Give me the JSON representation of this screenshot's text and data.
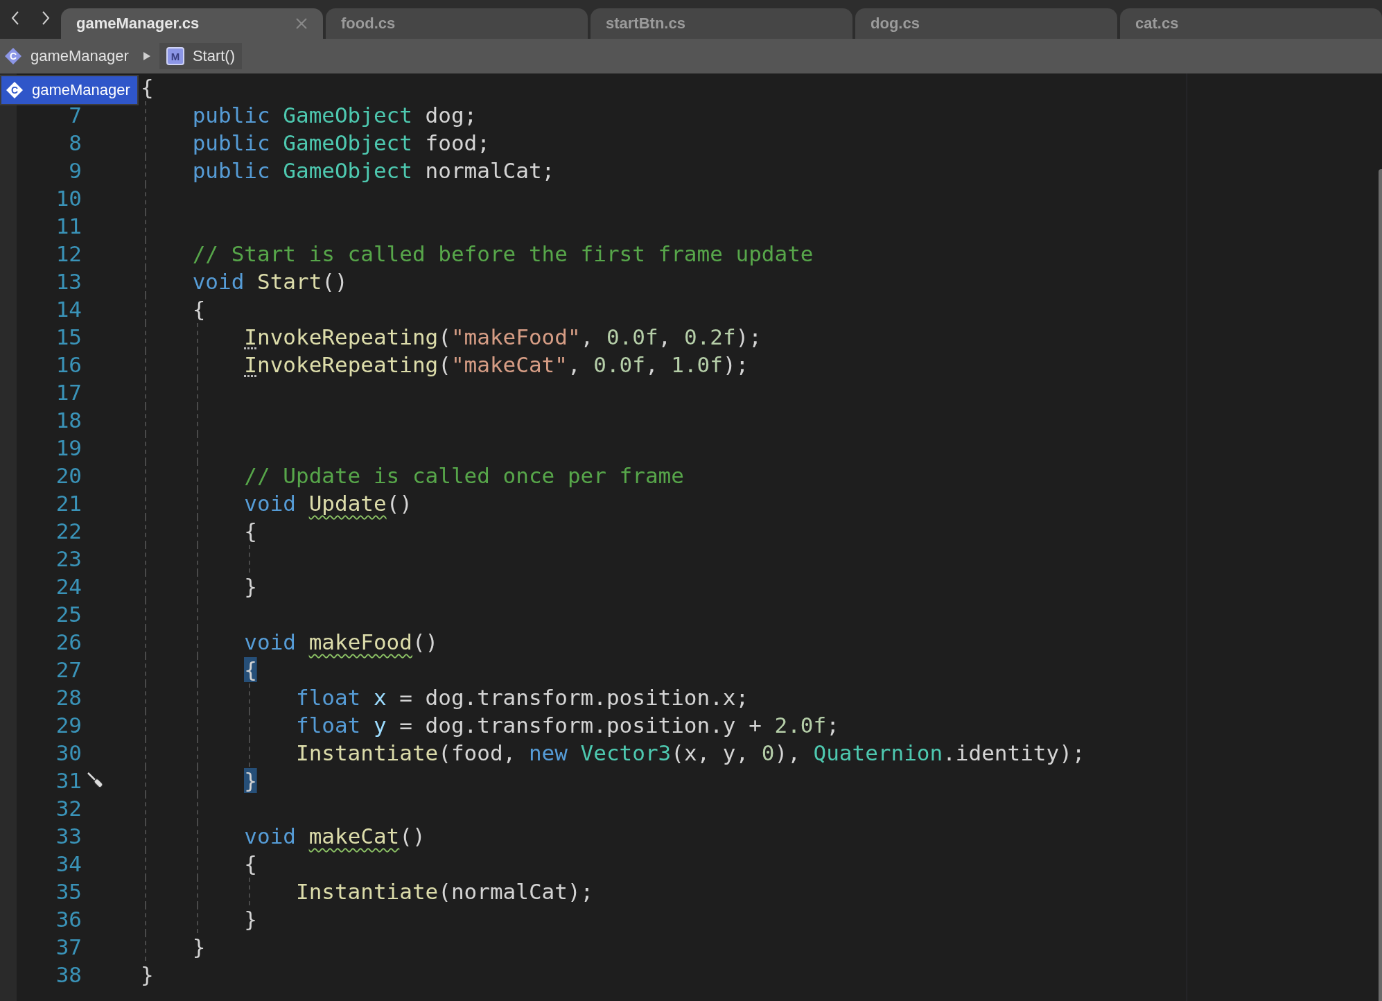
{
  "tabs": [
    {
      "label": "gameManager.cs",
      "selected": true
    },
    {
      "label": "food.cs",
      "selected": false
    },
    {
      "label": "startBtn.cs",
      "selected": false
    },
    {
      "label": "dog.cs",
      "selected": false
    },
    {
      "label": "cat.cs",
      "selected": false
    }
  ],
  "breadcrumb": [
    {
      "kind": "class",
      "badge": "C",
      "label": "gameManager"
    },
    {
      "kind": "method",
      "badge": "M",
      "label": "Start()"
    }
  ],
  "dropdown": {
    "badge": "C",
    "label": "gameManager"
  },
  "code_lines": [
    {
      "tokens": [
        {
          "kind": "plain",
          "text": "{"
        }
      ]
    },
    {
      "number": "7",
      "tokens": [
        {
          "kind": "keyword",
          "text": "    public"
        },
        {
          "kind": "type",
          "text": " GameObject"
        },
        {
          "kind": "plain",
          "text": " dog;"
        }
      ]
    },
    {
      "number": "8",
      "tokens": [
        {
          "kind": "keyword",
          "text": "    public"
        },
        {
          "kind": "type",
          "text": " GameObject"
        },
        {
          "kind": "plain",
          "text": " food;"
        }
      ]
    },
    {
      "number": "9",
      "tokens": [
        {
          "kind": "keyword",
          "text": "    public"
        },
        {
          "kind": "type",
          "text": " GameObject"
        },
        {
          "kind": "plain",
          "text": " normalCat;"
        }
      ]
    },
    {
      "number": "10"
    },
    {
      "number": "11"
    },
    {
      "number": "12",
      "tokens": [
        {
          "kind": "comment",
          "text": "    // Start is called before the first frame update"
        }
      ]
    },
    {
      "number": "13",
      "tokens": [
        {
          "kind": "keyword",
          "text": "    void"
        },
        {
          "kind": "method",
          "text": " Start"
        },
        {
          "kind": "plain",
          "text": "()"
        }
      ]
    },
    {
      "number": "14",
      "tokens": [
        {
          "kind": "plain",
          "text": "    {"
        }
      ]
    },
    {
      "number": "15",
      "tokens": [
        {
          "kind": "method",
          "text": "        I",
          "dotted": true
        },
        {
          "kind": "method",
          "text": "nvokeRepeating"
        },
        {
          "kind": "plain",
          "text": "("
        },
        {
          "kind": "string",
          "text": "\"makeFood\""
        },
        {
          "kind": "plain",
          "text": ", "
        },
        {
          "kind": "number",
          "text": "0.0f"
        },
        {
          "kind": "plain",
          "text": ", "
        },
        {
          "kind": "number",
          "text": "0.2f"
        },
        {
          "kind": "plain",
          "text": ");"
        }
      ]
    },
    {
      "number": "16",
      "tokens": [
        {
          "kind": "method",
          "text": "        I",
          "dotted": true
        },
        {
          "kind": "method",
          "text": "nvokeRepeating"
        },
        {
          "kind": "plain",
          "text": "("
        },
        {
          "kind": "string",
          "text": "\"makeCat\""
        },
        {
          "kind": "plain",
          "text": ", "
        },
        {
          "kind": "number",
          "text": "0.0f"
        },
        {
          "kind": "plain",
          "text": ", "
        },
        {
          "kind": "number",
          "text": "1.0f"
        },
        {
          "kind": "plain",
          "text": ");"
        }
      ]
    },
    {
      "number": "17"
    },
    {
      "number": "18"
    },
    {
      "number": "19"
    },
    {
      "number": "20",
      "tokens": [
        {
          "kind": "comment",
          "text": "        // Update is called once per frame"
        }
      ]
    },
    {
      "number": "21",
      "tokens": [
        {
          "kind": "keyword",
          "text": "        void "
        },
        {
          "kind": "method",
          "text": "Update",
          "squiggle": true
        },
        {
          "kind": "plain",
          "text": "()"
        }
      ]
    },
    {
      "number": "22",
      "tokens": [
        {
          "kind": "plain",
          "text": "        {"
        }
      ]
    },
    {
      "number": "23"
    },
    {
      "number": "24",
      "tokens": [
        {
          "kind": "plain",
          "text": "        }"
        }
      ]
    },
    {
      "number": "25"
    },
    {
      "number": "26",
      "tokens": [
        {
          "kind": "keyword",
          "text": "        void "
        },
        {
          "kind": "method",
          "text": "makeFood",
          "squiggle": true
        },
        {
          "kind": "plain",
          "text": "()"
        }
      ]
    },
    {
      "number": "27",
      "tokens": [
        {
          "kind": "plain",
          "text": "        {",
          "highlighted": true
        }
      ]
    },
    {
      "number": "28",
      "tokens": [
        {
          "kind": "keyword",
          "text": "            float"
        },
        {
          "kind": "local",
          "text": " x"
        },
        {
          "kind": "plain",
          "text": " = dog.transform.position.x;"
        }
      ]
    },
    {
      "number": "29",
      "tokens": [
        {
          "kind": "keyword",
          "text": "            float"
        },
        {
          "kind": "local",
          "text": " y"
        },
        {
          "kind": "plain",
          "text": " = dog.transform.position.y +"
        },
        {
          "kind": "number",
          "text": " 2.0f"
        },
        {
          "kind": "plain",
          "text": ";"
        }
      ]
    },
    {
      "number": "30",
      "tokens": [
        {
          "kind": "method",
          "text": "            Instantiate"
        },
        {
          "kind": "plain",
          "text": "(food,"
        },
        {
          "kind": "keyword",
          "text": " new"
        },
        {
          "kind": "type",
          "text": " Vector3"
        },
        {
          "kind": "plain",
          "text": "(x, y,"
        },
        {
          "kind": "number",
          "text": " 0"
        },
        {
          "kind": "plain",
          "text": "),"
        },
        {
          "kind": "type",
          "text": " Quaternion"
        },
        {
          "kind": "plain",
          "text": ".identity);"
        }
      ]
    },
    {
      "number": "31",
      "tokens": [
        {
          "kind": "plain",
          "text": "        }",
          "highlighted": true
        }
      ]
    },
    {
      "number": "32"
    },
    {
      "number": "33",
      "tokens": [
        {
          "kind": "keyword",
          "text": "        void "
        },
        {
          "kind": "method",
          "text": "makeCat",
          "squiggle": true
        },
        {
          "kind": "plain",
          "text": "()"
        }
      ]
    },
    {
      "number": "34",
      "tokens": [
        {
          "kind": "plain",
          "text": "        {"
        }
      ]
    },
    {
      "number": "35",
      "tokens": [
        {
          "kind": "method",
          "text": "            Instantiate"
        },
        {
          "kind": "plain",
          "text": "(normalCat);"
        }
      ]
    },
    {
      "number": "36",
      "tokens": [
        {
          "kind": "plain",
          "text": "        }"
        }
      ]
    },
    {
      "number": "37",
      "tokens": [
        {
          "kind": "plain",
          "text": "    }"
        }
      ]
    },
    {
      "number": "38",
      "tokens": [
        {
          "kind": "plain",
          "text": "}"
        }
      ]
    }
  ]
}
